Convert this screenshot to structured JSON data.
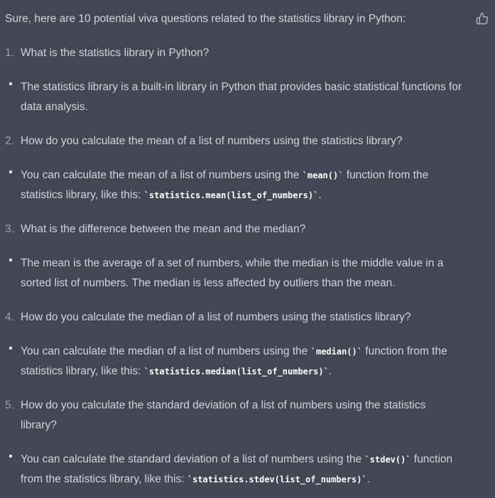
{
  "intro": "Sure, here are 10 potential viva questions related to the statistics library in Python:",
  "feedback": {
    "icon": "thumbs-up-icon",
    "color": "#acacbe"
  },
  "items": [
    {
      "num": "1.",
      "question": "What is the statistics library in Python?",
      "answer": [
        {
          "t": "text",
          "v": "The statistics library is a built-in library in Python that provides basic statistical functions for data analysis."
        }
      ]
    },
    {
      "num": "2.",
      "question": "How do you calculate the mean of a list of numbers using the statistics library?",
      "answer": [
        {
          "t": "text",
          "v": "You can calculate the mean of a list of numbers using the "
        },
        {
          "t": "code",
          "v": "`mean()`"
        },
        {
          "t": "text",
          "v": " function from the statistics library, like this: "
        },
        {
          "t": "code",
          "v": "`statistics.mean(list_of_numbers)`"
        },
        {
          "t": "text",
          "v": "."
        }
      ]
    },
    {
      "num": "3.",
      "question": "What is the difference between the mean and the median?",
      "answer": [
        {
          "t": "text",
          "v": "The mean is the average of a set of numbers, while the median is the middle value in a sorted list of numbers. The median is less affected by outliers than the mean."
        }
      ]
    },
    {
      "num": "4.",
      "question": "How do you calculate the median of a list of numbers using the statistics library?",
      "answer": [
        {
          "t": "text",
          "v": "You can calculate the median of a list of numbers using the "
        },
        {
          "t": "code",
          "v": "`median()`"
        },
        {
          "t": "text",
          "v": " function from the statistics library, like this: "
        },
        {
          "t": "code",
          "v": "`statistics.median(list_of_numbers)`"
        },
        {
          "t": "text",
          "v": "."
        }
      ]
    },
    {
      "num": "5.",
      "question": "How do you calculate the standard deviation of a list of numbers using the statistics library?",
      "answer": [
        {
          "t": "text",
          "v": "You can calculate the standard deviation of a list of numbers using the "
        },
        {
          "t": "code",
          "v": "`stdev()`"
        },
        {
          "t": "text",
          "v": " function from the statistics library, like this: "
        },
        {
          "t": "code",
          "v": "`statistics.stdev(list_of_numbers)`"
        },
        {
          "t": "text",
          "v": "."
        }
      ]
    }
  ]
}
